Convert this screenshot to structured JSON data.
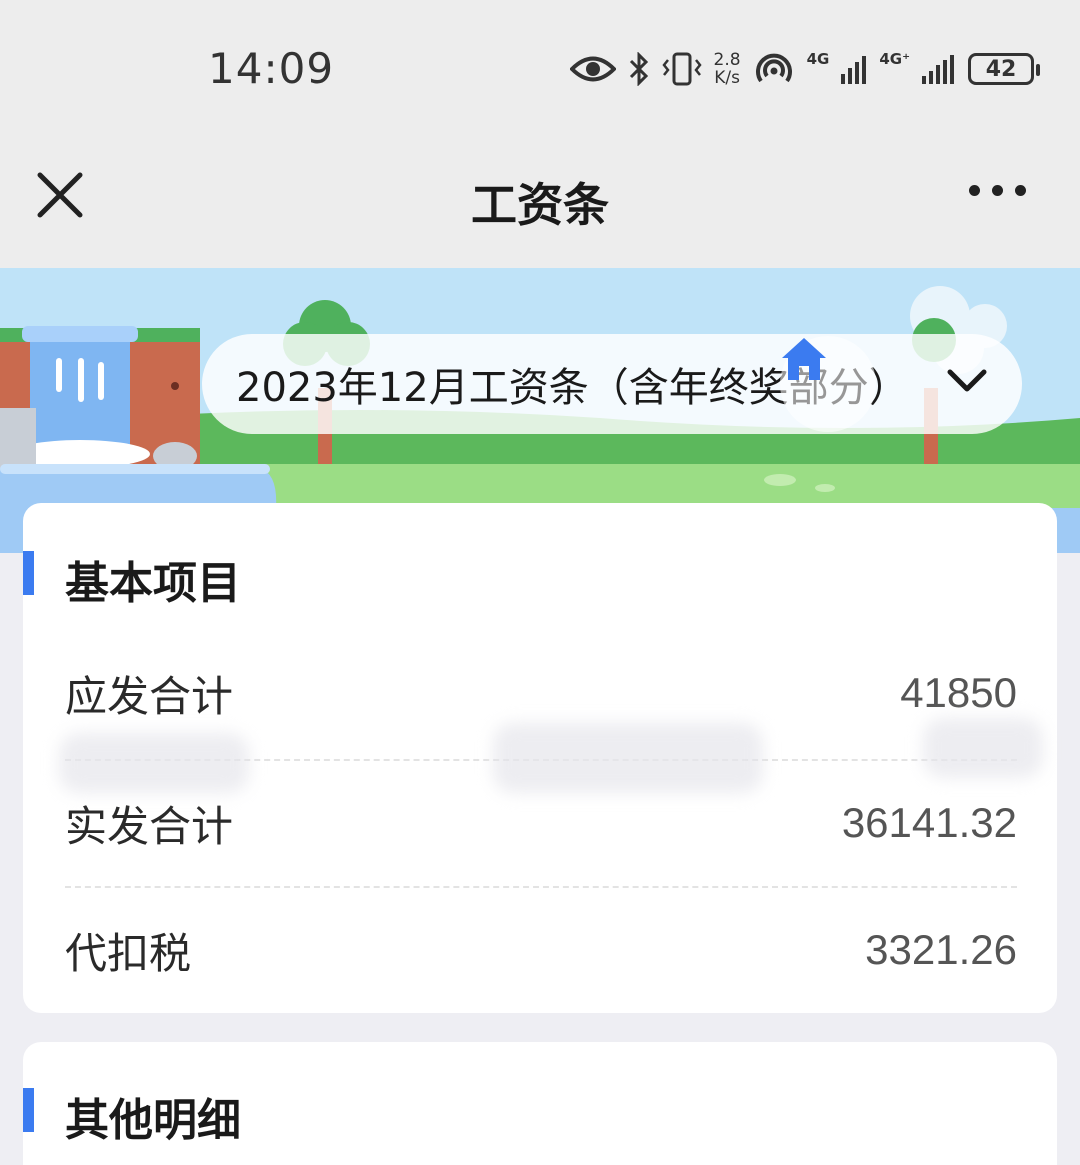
{
  "status_bar": {
    "time": "14:09",
    "speed_value": "2.8",
    "speed_unit": "K/s",
    "net1": "4G",
    "net2": "4G⁺",
    "battery": "42",
    "icons": [
      "eye-icon",
      "bluetooth-icon",
      "vibrate-icon",
      "hotspot-icon",
      "signal-icon",
      "battery-icon"
    ]
  },
  "navbar": {
    "title": "工资条"
  },
  "period_selector": {
    "text": "2023年12月工资条（含年终奖部分）"
  },
  "sections": {
    "basic": {
      "title": "基本项目",
      "rows": [
        {
          "label": "应发合计",
          "value": "41850"
        },
        {
          "label": "实发合计",
          "value": "36141.32"
        },
        {
          "label": "代扣税",
          "value": "3321.26"
        }
      ]
    },
    "other": {
      "title": "其他明细"
    }
  },
  "colors": {
    "accent": "#3b7bf0",
    "background": "#eeeef3",
    "navbar": "#ededed"
  }
}
